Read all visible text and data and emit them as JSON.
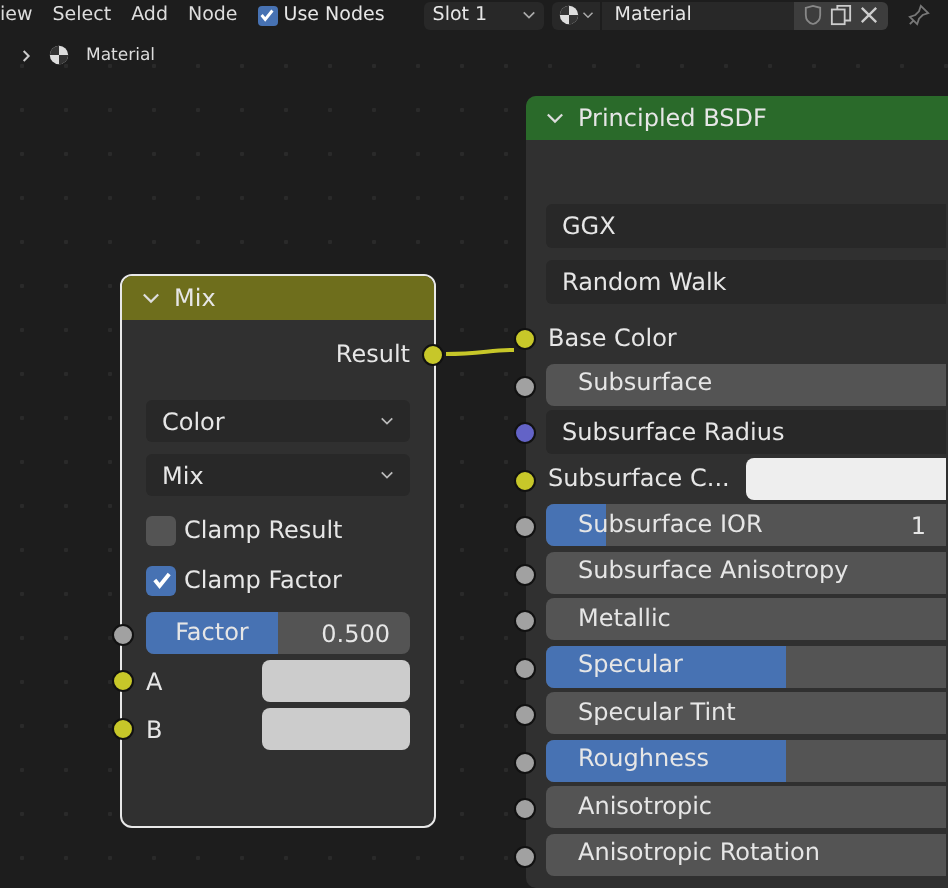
{
  "header": {
    "menus": [
      "iew",
      "Select",
      "Add",
      "Node"
    ],
    "use_nodes": {
      "label": "Use Nodes",
      "checked": true
    },
    "slot": "Slot 1",
    "material": "Material"
  },
  "breadcrumb": {
    "label": "Material"
  },
  "mix_node": {
    "title": "Mix",
    "output": "Result",
    "data_type": "Color",
    "blend_mode": "Mix",
    "options": [
      {
        "label": "Clamp Result",
        "checked": false
      },
      {
        "label": "Clamp Factor",
        "checked": true
      }
    ],
    "factor": {
      "label": "Factor",
      "value": "0.500",
      "level": 0.5
    },
    "inputs": [
      {
        "label": "A"
      },
      {
        "label": "B"
      }
    ]
  },
  "bsdf_node": {
    "title": "Principled BSDF",
    "dropdowns": [
      "GGX",
      "Random Walk"
    ],
    "inputs": [
      {
        "kind": "socket",
        "label": "Base Color",
        "color": "#c7c729"
      },
      {
        "kind": "slider",
        "label": "Subsurface",
        "color": "#a1a1a1",
        "level": 0
      },
      {
        "kind": "vector",
        "label": "Subsurface Radius",
        "color": "#6363c7"
      },
      {
        "kind": "color",
        "label": "Subsurface C...",
        "color": "#c7c729"
      },
      {
        "kind": "slider",
        "label": "Subsurface IOR",
        "color": "#a1a1a1",
        "level": 0.15,
        "value": "1"
      },
      {
        "kind": "slider",
        "label": "Subsurface Anisotropy",
        "color": "#a1a1a1",
        "level": 0
      },
      {
        "kind": "slider",
        "label": "Metallic",
        "color": "#a1a1a1",
        "level": 0
      },
      {
        "kind": "slider",
        "label": "Specular",
        "color": "#a1a1a1",
        "level": 0.6
      },
      {
        "kind": "slider",
        "label": "Specular Tint",
        "color": "#a1a1a1",
        "level": 0
      },
      {
        "kind": "slider",
        "label": "Roughness",
        "color": "#a1a1a1",
        "level": 0.6
      },
      {
        "kind": "slider",
        "label": "Anisotropic",
        "color": "#a1a1a1",
        "level": 0
      },
      {
        "kind": "slider",
        "label": "Anisotropic Rotation",
        "color": "#a1a1a1",
        "level": 0
      }
    ]
  }
}
